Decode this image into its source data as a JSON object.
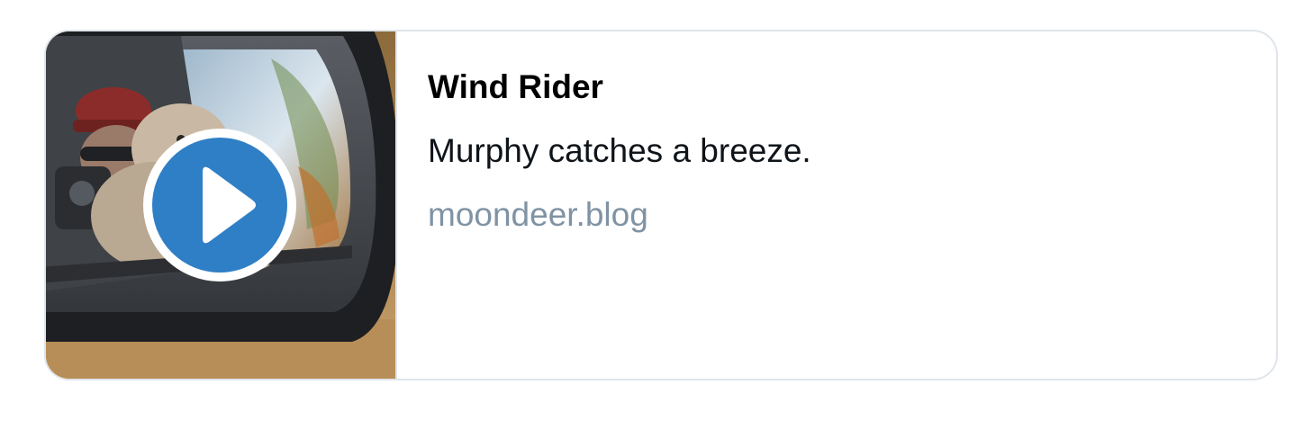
{
  "card": {
    "title": "Wind Rider",
    "description": "Murphy catches a breeze.",
    "domain": "moondeer.blog"
  },
  "media": {
    "thumbnail": "car-side-mirror-dog-photo",
    "overlay_icon": "play-icon",
    "play_button_color": "#2f7fc6"
  },
  "colors": {
    "border": "#dfe5ea",
    "title": "#000000",
    "domain": "#7f93a4"
  }
}
